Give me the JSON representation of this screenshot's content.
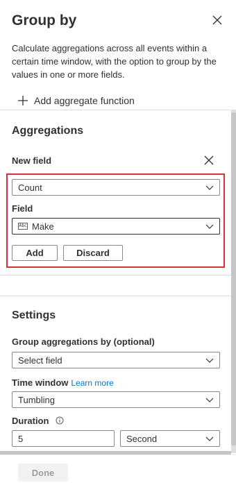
{
  "panel": {
    "title": "Group by",
    "description": "Calculate aggregations across all events within a certain time window, with the option to group by the values in one or more fields.",
    "add_aggregate_label": "Add aggregate function"
  },
  "aggregations": {
    "heading": "Aggregations",
    "new_field_label": "New field",
    "function_value": "Count",
    "field_label": "Field",
    "field_value": "Make",
    "field_type_badge": "Abc",
    "add_label": "Add",
    "discard_label": "Discard"
  },
  "settings": {
    "heading": "Settings",
    "group_by_label": "Group aggregations by (optional)",
    "group_by_placeholder": "Select field",
    "time_window_label": "Time window",
    "learn_more_label": "Learn more",
    "time_window_value": "Tumbling",
    "duration_label": "Duration",
    "duration_value": "5",
    "duration_unit": "Second"
  },
  "footer": {
    "done_label": "Done"
  },
  "colors": {
    "highlight": "#d13438",
    "link": "#0078d4",
    "text": "#323130"
  }
}
